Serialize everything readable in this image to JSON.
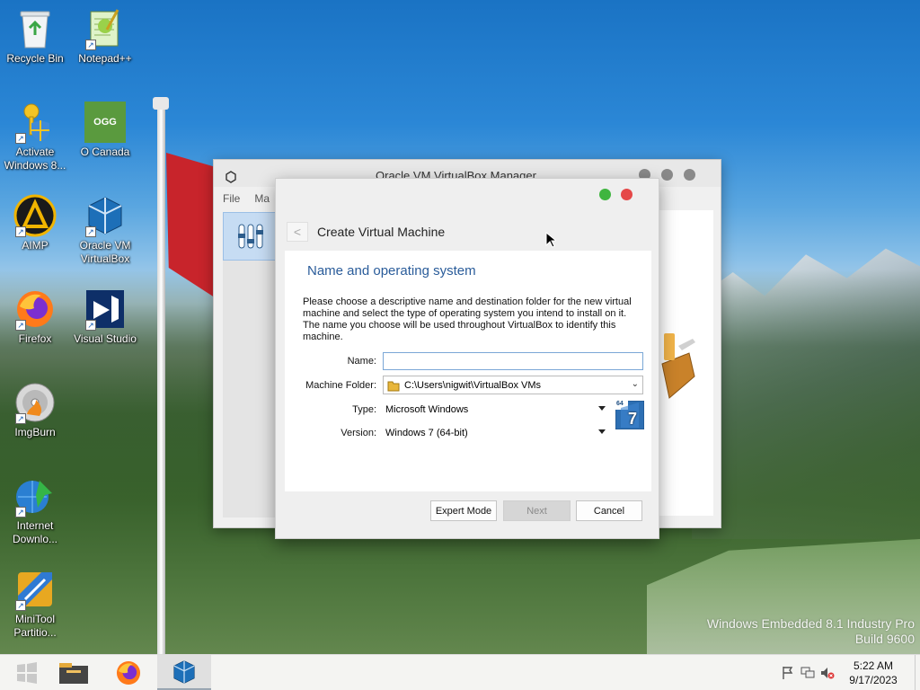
{
  "desktop": {
    "icons": [
      {
        "label": "Recycle Bin",
        "icon": "recycle-bin-icon"
      },
      {
        "label": "Notepad++",
        "icon": "notepad-plus-plus-icon"
      },
      {
        "label": "Activate Windows 8...",
        "icon": "key-shield-icon"
      },
      {
        "label": "O Canada",
        "icon": "ogg-file-icon",
        "badge": "OGG"
      },
      {
        "label": "AIMP",
        "icon": "aimp-icon"
      },
      {
        "label": "Oracle VM VirtualBox",
        "icon": "virtualbox-icon"
      },
      {
        "label": "Firefox",
        "icon": "firefox-icon"
      },
      {
        "label": "Visual Studio",
        "icon": "visual-studio-icon"
      },
      {
        "label": "ImgBurn",
        "icon": "imgburn-icon"
      },
      {
        "label": "Internet Downlo...",
        "icon": "internet-download-manager-icon"
      },
      {
        "label": "MiniTool Partitio...",
        "icon": "minitool-partition-icon"
      }
    ],
    "watermark": {
      "line1": "Windows Embedded 8.1 Industry Pro",
      "line2": "Build 9600"
    }
  },
  "manager_window": {
    "title": "Oracle VM VirtualBox Manager",
    "menu": [
      "File",
      "Ma"
    ]
  },
  "dialog": {
    "heading": "Create Virtual Machine",
    "back_glyph": "<",
    "page_title": "Name and operating system",
    "description": "Please choose a descriptive name and destination folder for the new virtual machine and select the type of operating system you intend to install on it. The name you choose will be used throughout VirtualBox to identify this machine.",
    "fields": {
      "name_label": "Name:",
      "name_value": "",
      "folder_label": "Machine Folder:",
      "folder_value": "C:\\Users\\nigwit\\VirtualBox VMs",
      "type_label": "Type:",
      "type_value": "Microsoft Windows",
      "version_label": "Version:",
      "version_value": "Windows 7 (64-bit)"
    },
    "os_badge": {
      "top": "64",
      "main": "7"
    },
    "buttons": {
      "expert": "Expert Mode",
      "next": "Next",
      "cancel": "Cancel"
    }
  },
  "taskbar": {
    "apps": [
      "start-icon",
      "file-explorer-icon",
      "firefox-icon",
      "virtualbox-icon"
    ],
    "clock": {
      "time": "5:22 AM",
      "date": "9/17/2023"
    }
  },
  "colors": {
    "accent_title": "#2a5c9a",
    "close_red": "#e54848",
    "zoom_green": "#3fb53f"
  }
}
